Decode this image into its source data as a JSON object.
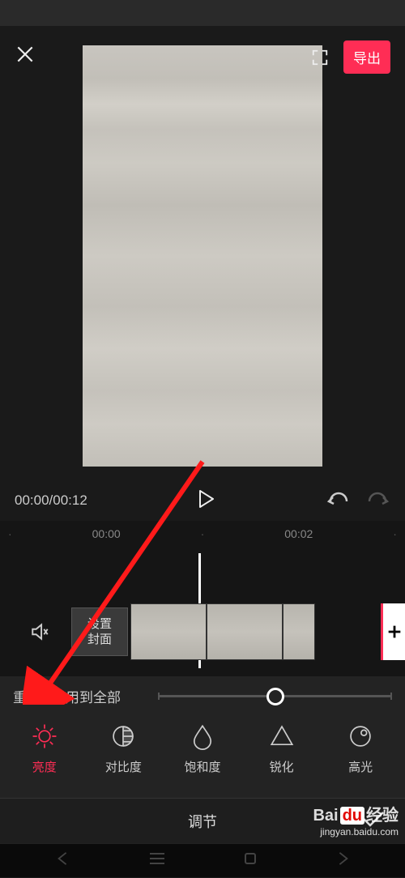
{
  "colors": {
    "accent": "#ff2d55",
    "bg": "#1a1a1a"
  },
  "header": {
    "export_label": "导出"
  },
  "playbar": {
    "time": "00:00/00:12"
  },
  "timeline": {
    "ticks": [
      "00:00",
      "00:02"
    ],
    "cover_label": "设置封面"
  },
  "adjust": {
    "reset_label": "重置",
    "apply_all_label": "应用到全部",
    "slider_value": 0,
    "options": [
      {
        "key": "brightness",
        "label": "亮度",
        "active": true
      },
      {
        "key": "contrast",
        "label": "对比度",
        "active": false
      },
      {
        "key": "saturation",
        "label": "饱和度",
        "active": false
      },
      {
        "key": "sharpen",
        "label": "锐化",
        "active": false
      },
      {
        "key": "highlight",
        "label": "高光",
        "active": false
      }
    ],
    "panel_title": "调节"
  },
  "watermark": {
    "brand_prefix": "Bai",
    "brand_mid": "du",
    "brand_suffix": "经验",
    "url": "jingyan.baidu.com"
  }
}
